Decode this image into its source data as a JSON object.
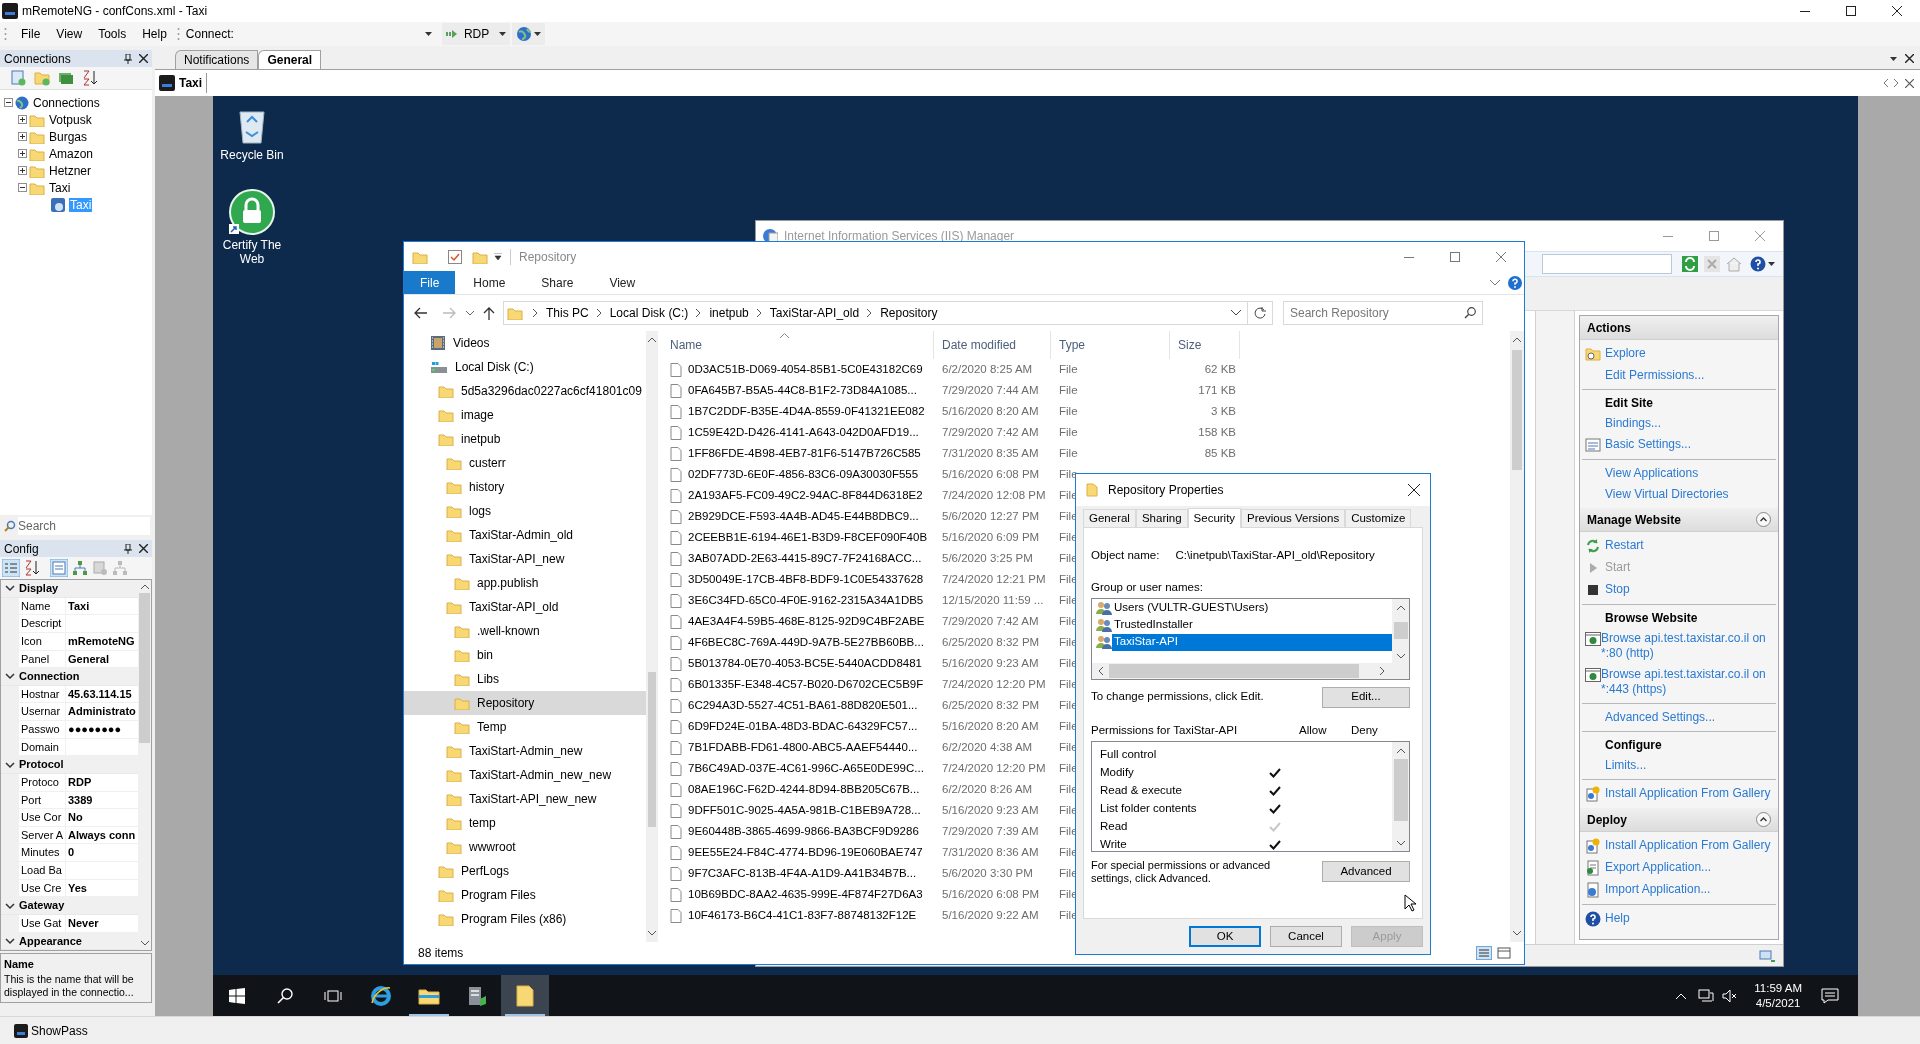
{
  "app": {
    "title": "mRemoteNG - confCons.xml - Taxi",
    "menu": [
      "File",
      "View",
      "Tools",
      "Help"
    ],
    "connect_label": "Connect:",
    "protocol": "RDP"
  },
  "connections": {
    "title": "Connections",
    "tree": [
      {
        "label": "Connections",
        "kind": "root",
        "expanded": true,
        "selected": false,
        "children": [
          {
            "label": "Votpusk",
            "kind": "folder",
            "expanded": false,
            "selected": false
          },
          {
            "label": "Burgas",
            "kind": "folder",
            "expanded": false,
            "selected": false
          },
          {
            "label": "Amazon",
            "kind": "folder",
            "expanded": false,
            "selected": false
          },
          {
            "label": "Hetzner",
            "kind": "folder",
            "expanded": false,
            "selected": false
          },
          {
            "label": "Taxi",
            "kind": "folder",
            "expanded": true,
            "selected": false,
            "children": [
              {
                "label": "Taxi",
                "kind": "connection",
                "selected": true
              }
            ]
          }
        ]
      }
    ]
  },
  "search": {
    "placeholder": "Search"
  },
  "config": {
    "title": "Config",
    "groups": [
      {
        "name": "Display",
        "expanded": true,
        "rows": [
          {
            "label": "Name",
            "value": "Taxi"
          },
          {
            "label": "Descript",
            "value": ""
          },
          {
            "label": "Icon",
            "value": "mRemoteNG"
          },
          {
            "label": "Panel",
            "value": "General"
          }
        ]
      },
      {
        "name": "Connection",
        "expanded": true,
        "rows": [
          {
            "label": "Hostnar",
            "value": "45.63.114.15"
          },
          {
            "label": "Usernar",
            "value": "Administrato"
          },
          {
            "label": "Passwo",
            "value": "●●●●●●●●"
          },
          {
            "label": "Domain",
            "value": ""
          }
        ]
      },
      {
        "name": "Protocol",
        "expanded": true,
        "rows": [
          {
            "label": "Protoco",
            "value": "RDP"
          },
          {
            "label": "Port",
            "value": "3389"
          },
          {
            "label": "Use Cor",
            "value": "No"
          },
          {
            "label": "Server A",
            "value": "Always conn"
          },
          {
            "label": "Minutes",
            "value": "0"
          },
          {
            "label": "Load Ba",
            "value": ""
          },
          {
            "label": "Use Cre",
            "value": "Yes"
          }
        ]
      },
      {
        "name": "Gateway",
        "expanded": true,
        "rows": [
          {
            "label": "Use Gat",
            "value": "Never"
          }
        ]
      },
      {
        "name": "Appearance",
        "expanded": true
      }
    ],
    "description": {
      "title": "Name",
      "text": "This is the name that will be displayed in the connectio..."
    }
  },
  "status_bar": {
    "button": "ShowPass"
  },
  "panel_tabs": [
    {
      "label": "Notifications",
      "selected": false
    },
    {
      "label": "General",
      "selected": true
    }
  ],
  "connection_tab": {
    "label": "Taxi"
  },
  "desktop": {
    "icons": [
      {
        "label": "Recycle Bin",
        "kind": "recycle"
      },
      {
        "label": "Certify The Web",
        "kind": "lock"
      }
    ],
    "taskbar": {
      "apps": [
        {
          "kind": "ie",
          "running": false,
          "selected": false
        },
        {
          "kind": "explorer",
          "running": true,
          "selected": false
        },
        {
          "kind": "server",
          "running": false,
          "selected": false
        },
        {
          "kind": "folder",
          "running": true,
          "selected": true
        }
      ],
      "time": "11:59 AM",
      "date": "4/5/2021"
    }
  },
  "iis": {
    "title": "Internet Information Services (IIS) Manager",
    "sections": [
      {
        "title": "Actions",
        "groups": [
          {
            "items": [
              {
                "label": "Explore",
                "kind": "explore",
                "disabled": false
              },
              {
                "label": "Edit Permissions...",
                "kind": "link",
                "disabled": false
              }
            ]
          },
          {
            "heading": "Edit Site",
            "items": [
              {
                "label": "Bindings...",
                "kind": "link",
                "disabled": false
              },
              {
                "label": "Basic Settings...",
                "kind": "settings",
                "disabled": false
              }
            ]
          },
          {
            "items": [
              {
                "label": "View Applications",
                "kind": "link",
                "disabled": false
              },
              {
                "label": "View Virtual Directories",
                "kind": "link",
                "disabled": false
              }
            ]
          }
        ]
      },
      {
        "title": "Manage Website",
        "expanded": true,
        "groups": [
          {
            "items": [
              {
                "label": "Restart",
                "kind": "restart",
                "disabled": false
              },
              {
                "label": "Start",
                "kind": "start",
                "disabled": true
              },
              {
                "label": "Stop",
                "kind": "stop",
                "disabled": false
              }
            ]
          },
          {
            "heading": "Browse Website",
            "items": [
              {
                "label": "Browse api.test.taxistar.co.il on *:80 (http)",
                "kind": "browse",
                "disabled": false
              },
              {
                "label": "Browse api.test.taxistar.co.il on *:443 (https)",
                "kind": "browse",
                "disabled": false
              }
            ]
          },
          {
            "items": [
              {
                "label": "Advanced Settings...",
                "kind": "link",
                "disabled": false
              }
            ]
          },
          {
            "heading": "Configure",
            "items": [
              {
                "label": "Limits...",
                "kind": "link",
                "disabled": false
              }
            ]
          },
          {
            "items": [
              {
                "label": "Install Application From Gallery",
                "kind": "install",
                "disabled": false
              }
            ]
          }
        ]
      },
      {
        "title": "Deploy",
        "expanded": true,
        "groups": [
          {
            "items": [
              {
                "label": "Install Application From Gallery",
                "kind": "install",
                "disabled": false
              },
              {
                "label": "Export Application...",
                "kind": "export",
                "disabled": false
              },
              {
                "label": "Import Application...",
                "kind": "import",
                "disabled": false
              }
            ]
          },
          {
            "items": [
              {
                "label": "Help",
                "kind": "help",
                "disabled": false
              }
            ]
          }
        ]
      }
    ]
  },
  "explorer": {
    "title": "Repository",
    "ribbon_tabs": [
      {
        "label": "File",
        "selected": true
      },
      {
        "label": "Home",
        "selected": false
      },
      {
        "label": "Share",
        "selected": false
      },
      {
        "label": "View",
        "selected": false
      }
    ],
    "breadcrumbs": [
      "This PC",
      "Local Disk (C:)",
      "inetpub",
      "TaxiStar-API_old",
      "Repository"
    ],
    "search": {
      "placeholder": "Search Repository"
    },
    "nav": [
      {
        "label": "Videos",
        "kind": "video",
        "selected": false
      },
      {
        "label": "Local Disk (C:)",
        "kind": "drive",
        "selected": false,
        "children": [
          {
            "label": "5d5a3296dac0227ac6cf41801c09",
            "kind": "folder",
            "selected": false
          },
          {
            "label": "image",
            "kind": "folder",
            "selected": false
          },
          {
            "label": "inetpub",
            "kind": "folder",
            "selected": false,
            "children": [
              {
                "label": "custerr",
                "kind": "folder",
                "selected": false
              },
              {
                "label": "history",
                "kind": "folder",
                "selected": false
              },
              {
                "label": "logs",
                "kind": "folder",
                "selected": false
              },
              {
                "label": "TaxiStar-Admin_old",
                "kind": "folder",
                "selected": false
              },
              {
                "label": "TaxiStar-API_new",
                "kind": "folder",
                "selected": false,
                "children": [
                  {
                    "label": "app.publish",
                    "kind": "folder",
                    "selected": false
                  }
                ]
              },
              {
                "label": "TaxiStar-API_old",
                "kind": "folder",
                "selected": false,
                "children": [
                  {
                    "label": ".well-known",
                    "kind": "folder",
                    "selected": false
                  },
                  {
                    "label": "bin",
                    "kind": "folder",
                    "selected": false
                  },
                  {
                    "label": "Libs",
                    "kind": "folder",
                    "selected": false
                  },
                  {
                    "label": "Repository",
                    "kind": "folder",
                    "selected": true
                  },
                  {
                    "label": "Temp",
                    "kind": "folder",
                    "selected": false
                  }
                ]
              },
              {
                "label": "TaxiStart-Admin_new",
                "kind": "folder",
                "selected": false
              },
              {
                "label": "TaxiStart-Admin_new_new",
                "kind": "folder",
                "selected": false
              },
              {
                "label": "TaxiStart-API_new_new",
                "kind": "folder",
                "selected": false
              },
              {
                "label": "temp",
                "kind": "folder",
                "selected": false
              },
              {
                "label": "wwwroot",
                "kind": "folder",
                "selected": false
              }
            ]
          },
          {
            "label": "PerfLogs",
            "kind": "folder",
            "selected": false
          },
          {
            "label": "Program Files",
            "kind": "folder",
            "selected": false
          },
          {
            "label": "Program Files (x86)",
            "kind": "folder",
            "selected": false
          }
        ]
      }
    ],
    "columns": [
      "Name",
      "Date modified",
      "Type",
      "Size"
    ],
    "rows": [
      {
        "name": "0D3AC51B-D069-4054-85B1-5C0E43182C69",
        "date": "6/2/2020 8:25 AM",
        "type": "File",
        "size": "62 KB"
      },
      {
        "name": "0FA645B7-B5A5-44C8-B1F2-73D84A1085...",
        "date": "7/29/2020 7:44 AM",
        "type": "File",
        "size": "171 KB"
      },
      {
        "name": "1B7C2DDF-B35E-4D4A-8559-0F41321EE082",
        "date": "5/16/2020 8:20 AM",
        "type": "File",
        "size": "3 KB"
      },
      {
        "name": "1C59E42D-D426-4141-A643-042D0AFD19...",
        "date": "7/29/2020 7:42 AM",
        "type": "File",
        "size": "158 KB"
      },
      {
        "name": "1FF86FDE-4B98-4EB7-81F6-5147B726C585",
        "date": "7/31/2020 8:35 AM",
        "type": "File",
        "size": "85 KB"
      },
      {
        "name": "02DF773D-6E0F-4856-83C6-09A30030F555",
        "date": "5/16/2020 6:08 PM",
        "type": "File"
      },
      {
        "name": "2A193AF5-FC09-49C2-94AC-8F844D6318E2",
        "date": "7/24/2020 12:08 PM",
        "type": "File"
      },
      {
        "name": "2B929DCE-F593-4A4B-AD45-E44B8DBC9...",
        "date": "5/6/2020 12:27 PM",
        "type": "File"
      },
      {
        "name": "2CEEBB1E-6194-46E1-B3D9-F8CEF090F40B",
        "date": "5/16/2020 6:09 PM",
        "type": "File"
      },
      {
        "name": "3AB07ADD-2E63-4415-89C7-7F24168ACC...",
        "date": "5/6/2020 3:25 PM",
        "type": "File"
      },
      {
        "name": "3D50049E-17CB-4BF8-BDF9-1C0E54337628",
        "date": "7/24/2020 12:21 PM",
        "type": "File"
      },
      {
        "name": "3E6C34FD-65C0-4F0E-9162-2315A34A1DB5",
        "date": "12/15/2020 11:59 ...",
        "type": "File"
      },
      {
        "name": "4AE3A4F4-59B5-468E-8125-92D9C4BF2ABE",
        "date": "7/29/2020 7:42 AM",
        "type": "File"
      },
      {
        "name": "4F6BEC8C-769A-449D-9A7B-5E27BB60BB...",
        "date": "6/25/2020 8:32 PM",
        "type": "File"
      },
      {
        "name": "5B013784-0E70-4053-BC5E-5440ACDD8481",
        "date": "5/16/2020 9:23 AM",
        "type": "File"
      },
      {
        "name": "6B01335F-E348-4C57-B020-D6702CEC5B9F",
        "date": "7/24/2020 12:20 PM",
        "type": "File"
      },
      {
        "name": "6C294A3D-5527-4C51-BA61-88D820E501...",
        "date": "6/25/2020 8:32 PM",
        "type": "File"
      },
      {
        "name": "6D9FD24E-01BA-48D3-BDAC-64329FC57...",
        "date": "5/16/2020 8:20 AM",
        "type": "File"
      },
      {
        "name": "7B1FDABB-FD61-4800-ABC5-AAEF54440...",
        "date": "6/2/2020 4:38 AM",
        "type": "File"
      },
      {
        "name": "7B6C49AD-037E-4C61-996C-A65E0DE99C...",
        "date": "7/24/2020 12:20 PM",
        "type": "File"
      },
      {
        "name": "08AE196C-F62D-4244-8D94-8BB205C67B...",
        "date": "6/2/2020 8:26 AM",
        "type": "File"
      },
      {
        "name": "9DFF501C-9025-4A5A-981B-C1BEB9A728...",
        "date": "5/16/2020 9:23 AM",
        "type": "File"
      },
      {
        "name": "9E60448B-3865-4699-9866-BA3BCF9D9286",
        "date": "7/29/2020 7:39 AM",
        "type": "File"
      },
      {
        "name": "9EE55E24-F84C-4774-BD96-19E060BAE747",
        "date": "7/31/2020 8:36 AM",
        "type": "File"
      },
      {
        "name": "9F7C3AFC-813B-4F4A-A1D9-A41B34B7B...",
        "date": "5/6/2020 3:30 PM",
        "type": "File"
      },
      {
        "name": "10B69BDC-8AA2-4635-999E-4F874F27D6A3",
        "date": "5/16/2020 6:08 PM",
        "type": "File"
      },
      {
        "name": "10F46173-B6C4-41C1-83F7-88748132F12E",
        "date": "5/16/2020 9:22 AM",
        "type": "File"
      }
    ],
    "status": "88 items"
  },
  "properties": {
    "title": "Repository Properties",
    "tabs": [
      {
        "label": "General",
        "selected": false
      },
      {
        "label": "Sharing",
        "selected": false
      },
      {
        "label": "Security",
        "selected": true
      },
      {
        "label": "Previous Versions",
        "selected": false
      },
      {
        "label": "Customize",
        "selected": false
      }
    ],
    "object_label": "Object name:",
    "object_value": "C:\\inetpub\\TaxiStar-API_old\\Repository",
    "groups_label": "Group or user names:",
    "principals": [
      {
        "name": "Users (VULTR-GUEST\\Users)",
        "selected": false
      },
      {
        "name": "TrustedInstaller",
        "selected": false
      },
      {
        "name": "TaxiStar-API",
        "selected": true
      }
    ],
    "change_hint": "To change permissions, click Edit.",
    "edit_button": "Edit...",
    "permissions_label": "Permissions for TaxiStar-API",
    "allow_label": "Allow",
    "deny_label": "Deny",
    "permissions": [
      {
        "name": "Full control",
        "allow": false,
        "deny": false
      },
      {
        "name": "Modify",
        "allow": true,
        "inherited": false,
        "deny": false
      },
      {
        "name": "Read & execute",
        "allow": true,
        "inherited": false,
        "deny": false
      },
      {
        "name": "List folder contents",
        "allow": true,
        "inherited": false,
        "deny": false
      },
      {
        "name": "Read",
        "allow": true,
        "inherited": true,
        "deny": false
      },
      {
        "name": "Write",
        "allow": true,
        "inherited": false,
        "deny": false
      }
    ],
    "advanced_hint": "For special permissions or advanced settings, click Advanced.",
    "advanced_button": "Advanced",
    "buttons": [
      {
        "label": "OK",
        "default": true,
        "disabled": false
      },
      {
        "label": "Cancel",
        "default": false,
        "disabled": false
      },
      {
        "label": "Apply",
        "default": false,
        "disabled": true
      }
    ]
  }
}
